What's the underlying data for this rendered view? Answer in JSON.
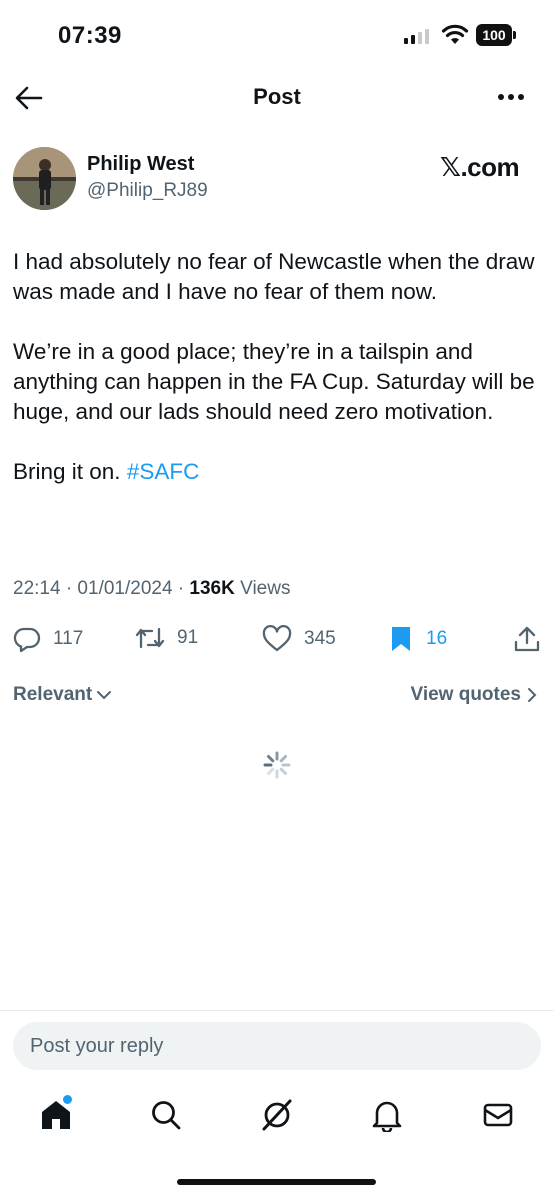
{
  "status_bar": {
    "time": "07:39",
    "battery": "100"
  },
  "header": {
    "title": "Post"
  },
  "author": {
    "name": "Philip West",
    "handle": "@Philip_RJ89",
    "badge": "𝕏.com"
  },
  "tweet": {
    "paragraph1": "I had absolutely no fear of Newcastle when the draw was made and I have no fear of them now.",
    "paragraph2": "We’re in a good place; they’re in a tailspin and anything can happen in the FA Cup. Saturday will be huge, and our lads should need zero motivation.",
    "paragraph3": "Bring it on. ",
    "hashtag": "#SAFC"
  },
  "meta": {
    "timestamp": "22:14 · 01/01/2024 · ",
    "views_count": "136K",
    "views_label": " Views"
  },
  "actions": {
    "replies": "117",
    "reposts": "91",
    "likes": "345",
    "bookmarks": "16"
  },
  "filters": {
    "relevant": "Relevant",
    "view_quotes": "View quotes"
  },
  "reply": {
    "placeholder": "Post your reply"
  },
  "colors": {
    "accent": "#1d9bf0",
    "secondary_text": "#536471",
    "text": "#0f1419"
  }
}
